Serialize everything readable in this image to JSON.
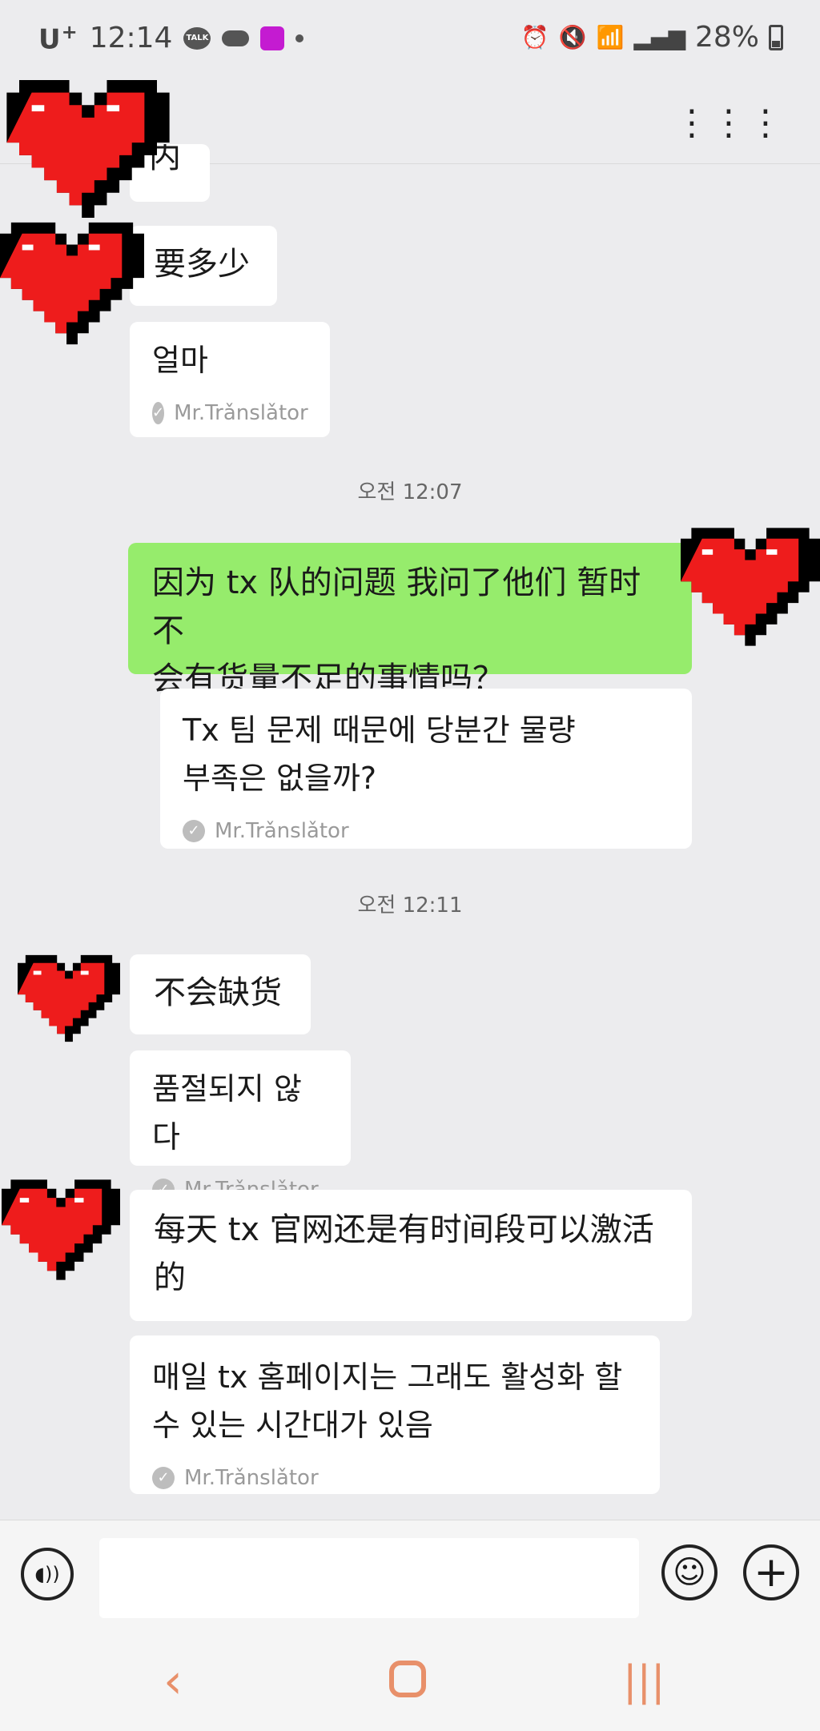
{
  "status_bar": {
    "carrier": "U",
    "carrier_sup": "+",
    "time": "12:14",
    "talk_badge": "TALK",
    "battery": "28%"
  },
  "colors": {
    "background": "#ececee",
    "my_bubble": "#96ec6c",
    "their_bubble": "#ffffff",
    "nav_accent": "#e8906a"
  },
  "messages": {
    "m0": {
      "text": "内"
    },
    "m1": {
      "text": "要多少"
    },
    "t1": {
      "text": "얼마",
      "translator": "Mr.Trǎnslǎtor"
    },
    "ts1": {
      "text": "오전 12:07"
    },
    "m2": {
      "text": "因为 tx 队的问题 我问了他们 暂时不\n会有货量不足的事情吗？"
    },
    "t2": {
      "text": "Tx 팀 문제 때문에 당분간 물량\n부족은 없을까?",
      "translator": "Mr.Trǎnslǎtor"
    },
    "ts2": {
      "text": "오전 12:11"
    },
    "m3": {
      "text": "不会缺货"
    },
    "t3": {
      "text": "품절되지 않다",
      "translator": "Mr.Trǎnslǎtor"
    },
    "m4": {
      "text": "每天 tx 官网还是有时间段可以激活\n的"
    },
    "t4": {
      "text": "매일 tx 홈페이지는 그래도 활성화 할\n수 있는 시간대가 있음",
      "translator": "Mr.Trǎnslǎtor"
    }
  },
  "icons": {
    "more": "more-icon",
    "voice": "voice-icon",
    "emoji": "emoji-icon",
    "plus": "plus-icon",
    "back": "back-icon",
    "home": "home-icon",
    "recents": "recents-icon"
  }
}
